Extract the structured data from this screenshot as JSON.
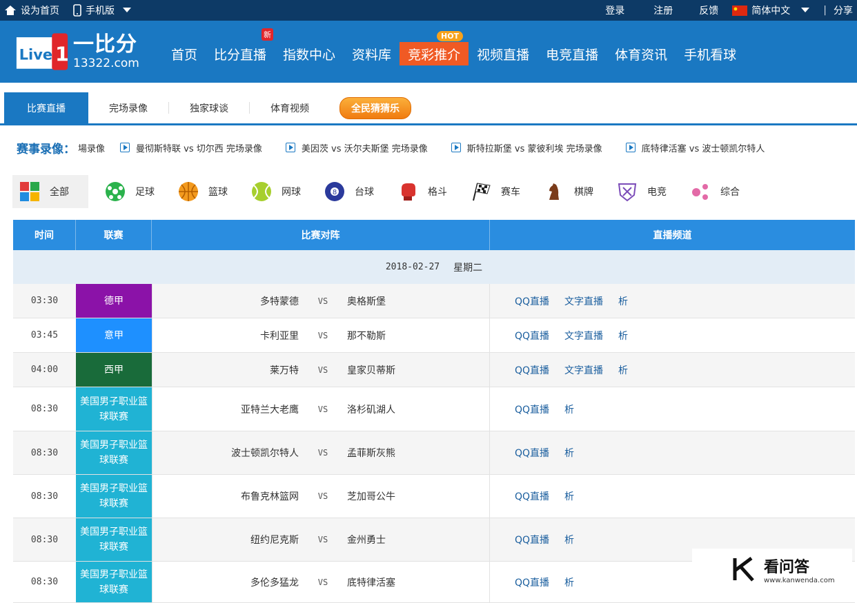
{
  "topbar": {
    "set_home": "设为首页",
    "mobile": "手机版",
    "login": "登录",
    "register": "注册",
    "feedback": "反馈",
    "language": "简体中文",
    "share": "分享",
    "separator": "|"
  },
  "logo": {
    "brand": "一比分",
    "domain": "13322.com",
    "live_text": "Live"
  },
  "nav": {
    "items": [
      "首页",
      "比分直播",
      "指数中心",
      "资料库",
      "竞彩推介",
      "视频直播",
      "电竞直播",
      "体育资讯",
      "手机看球"
    ],
    "badge_new": "新",
    "badge_hot": "HOT"
  },
  "subtabs": {
    "items": [
      "比赛直播",
      "完场录像",
      "独家球谈",
      "体育视频"
    ],
    "fun_button": "全民猜猜乐"
  },
  "replays": {
    "label": "赛事录像：",
    "first": "場录像",
    "items": [
      "曼彻斯特联 vs 切尔西  完场录像",
      "美因茨 vs 沃尔夫斯堡  完场录像",
      "斯特拉斯堡 vs 蒙彼利埃  完场录像",
      "底特律活塞 vs 波士顿凯尔特人"
    ]
  },
  "sports": [
    {
      "label": "全部",
      "icon": "grid-icon"
    },
    {
      "label": "足球",
      "icon": "football-icon"
    },
    {
      "label": "篮球",
      "icon": "basketball-icon"
    },
    {
      "label": "网球",
      "icon": "tennis-icon"
    },
    {
      "label": "台球",
      "icon": "billiards-icon"
    },
    {
      "label": "格斗",
      "icon": "boxing-icon"
    },
    {
      "label": "赛车",
      "icon": "racing-flag-icon"
    },
    {
      "label": "棋牌",
      "icon": "chess-knight-icon"
    },
    {
      "label": "电竞",
      "icon": "esports-shield-icon"
    },
    {
      "label": "综合",
      "icon": "dots-icon"
    }
  ],
  "table": {
    "headers": [
      "时间",
      "联赛",
      "比赛对阵",
      "直播频道"
    ],
    "date": "2018-02-27",
    "weekday": "星期二",
    "rows": [
      {
        "time": "03:30",
        "league": "德甲",
        "league_color": "#8b12a8",
        "home": "多特蒙德",
        "vs": "VS",
        "away": "奥格斯堡",
        "channels": [
          "QQ直播",
          "文字直播",
          "析"
        ]
      },
      {
        "time": "03:45",
        "league": "意甲",
        "league_color": "#1e90ff",
        "home": "卡利亚里",
        "vs": "VS",
        "away": "那不勒斯",
        "channels": [
          "QQ直播",
          "文字直播",
          "析"
        ]
      },
      {
        "time": "04:00",
        "league": "西甲",
        "league_color": "#196b3a",
        "home": "莱万特",
        "vs": "VS",
        "away": "皇家贝蒂斯",
        "channels": [
          "QQ直播",
          "文字直播",
          "析"
        ]
      },
      {
        "time": "08:30",
        "league": "美国男子职业篮球联赛",
        "league_color": "#20b3d4",
        "home": "亚特兰大老鹰",
        "vs": "VS",
        "away": "洛杉矶湖人",
        "channels": [
          "QQ直播",
          "析"
        ]
      },
      {
        "time": "08:30",
        "league": "美国男子职业篮球联赛",
        "league_color": "#20b3d4",
        "home": "波士顿凯尔特人",
        "vs": "VS",
        "away": "孟菲斯灰熊",
        "channels": [
          "QQ直播",
          "析"
        ]
      },
      {
        "time": "08:30",
        "league": "美国男子职业篮球联赛",
        "league_color": "#20b3d4",
        "home": "布鲁克林篮网",
        "vs": "VS",
        "away": "芝加哥公牛",
        "channels": [
          "QQ直播",
          "析"
        ]
      },
      {
        "time": "08:30",
        "league": "美国男子职业篮球联赛",
        "league_color": "#20b3d4",
        "home": "纽约尼克斯",
        "vs": "VS",
        "away": "金州勇士",
        "channels": [
          "QQ直播",
          "析"
        ]
      },
      {
        "time": "08:30",
        "league": "美国男子职业篮球联赛",
        "league_color": "#20b3d4",
        "home": "多伦多猛龙",
        "vs": "VS",
        "away": "底特律活塞",
        "channels": [
          "QQ直播",
          "析"
        ]
      }
    ]
  },
  "watermark": {
    "title": "看问答",
    "url": "www.kanwenda.com"
  }
}
